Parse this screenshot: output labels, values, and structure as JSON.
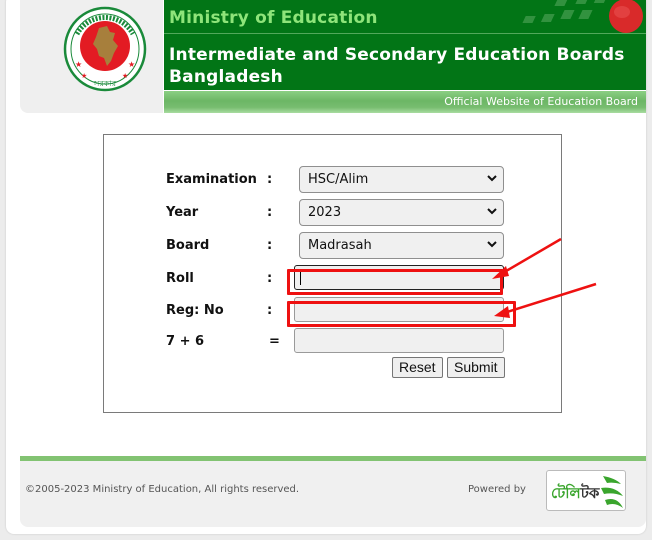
{
  "header": {
    "ministry": "Ministry of Education",
    "title_line1": "Intermediate and Secondary Education Boards",
    "title_line2": "Bangladesh",
    "tagline": "Official Website of Education Board",
    "logo": "bangladesh-government-seal-icon"
  },
  "form": {
    "fields": [
      {
        "label": "Examination",
        "sep": ":",
        "type": "select",
        "value": "HSC/Alim"
      },
      {
        "label": "Year",
        "sep": ":",
        "type": "select",
        "value": "2023"
      },
      {
        "label": "Board",
        "sep": ":",
        "type": "select",
        "value": "Madrasah"
      },
      {
        "label": "Roll",
        "sep": ":",
        "type": "text",
        "value": "",
        "focused": true
      },
      {
        "label": "Reg: No",
        "sep": ":",
        "type": "text",
        "value": ""
      },
      {
        "label": "7 + 6",
        "sep": "=",
        "type": "text",
        "value": ""
      }
    ],
    "reset_label": "Reset",
    "submit_label": "Submit"
  },
  "annotations": {
    "highlight_color": "#ee1111",
    "highlighted_fields": [
      "Roll",
      "Reg: No"
    ]
  },
  "footer": {
    "copyright": "©2005-2023 Ministry of Education, All rights reserved.",
    "powered_by": "Powered by",
    "partner_logo_text_a": "টেলি",
    "partner_logo_text_b": "টক"
  },
  "colors": {
    "banner_green": "#027516",
    "ministry_text": "#8ee47a",
    "footer_accent": "#82c372"
  }
}
